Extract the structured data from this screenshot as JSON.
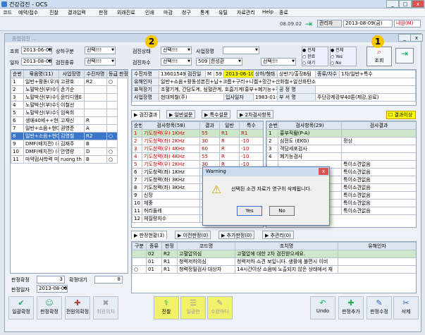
{
  "window": {
    "title": "건강검진 - OCS"
  },
  "menu": [
    "코드",
    "예약/접수",
    "진찰",
    "결과입력",
    "판정",
    "외래진료",
    "인쇄",
    "마감",
    "청구",
    "통계",
    "유틸",
    "자료관리",
    "Help",
    "종료"
  ],
  "top": {
    "version": "08.09.02",
    "role": "관리자",
    "date": "2013-08-09(금)",
    "tab": "내원(M)"
  },
  "inner_title": "종합검진 ...",
  "filters": {
    "jo_label": "조회",
    "jo_date": "2013-06-09",
    "ilja_label": "일자",
    "ilja_date": "2013-08-09",
    "sanghagubun_label": "상하구분",
    "sanghagubun_val": "선택!!!",
    "geomjinjongryu_label": "검진종류",
    "geomjinjongryu_val": "선택!!!",
    "geomjinsangtae_label": "검진상태",
    "geomjinsangtae_val": "선택!!!",
    "geomjinchasu_label": "검진차수",
    "geomjinchasu_val": "선택!!!",
    "saeopjang_label": "사업장명",
    "saeopjang_val": "",
    "saeopjang2_val": "509 |한성환",
    "saeopjang3_val": "선택!!!",
    "radio1": [
      "전체",
      "완료",
      "대기"
    ],
    "radio2": [
      "전체",
      "Yes",
      "No"
    ],
    "search_btn": "조회"
  },
  "list": {
    "headers": [
      "순번",
      "묶음명(11)",
      "사업장명",
      "수진자명",
      "등급",
      "판정"
    ],
    "rows": [
      [
        "1",
        "일반+활동(우)부선",
        "고광호",
        "R2",
        "○"
      ],
      [
        "2",
        "노말박산(부)수영진기타",
        "손기순",
        "",
        ""
      ],
      [
        "3",
        "노말박산(부)수영진기타",
        "윤티디엠E",
        "",
        ""
      ],
      [
        "4",
        "노말박산(부)수영진기타",
        "이철선",
        "",
        ""
      ],
      [
        "5",
        "노말박산(부)수영진기타",
        "임옥희",
        "",
        ""
      ],
      [
        "6",
        "생애40세++현대제출(",
        "고재신",
        "R",
        ""
      ],
      [
        "7",
        "일반+소음+현대제출(",
        "권영준",
        "A",
        ""
      ],
      [
        "8",
        "일반+소음+현대제출(",
        "김영철",
        "R2",
        "○"
      ],
      [
        "9",
        "DMF(배치전) (주)이아이",
        "김재주",
        "B",
        ""
      ],
      [
        "10",
        "DMF(배치전) (주)이아이",
        "안영량",
        "D",
        "○"
      ],
      [
        "11",
        "마약검사학력 미래테크",
        "ruong th",
        "B",
        "○"
      ]
    ]
  },
  "summary": {
    "pangjeong_label": "판정확정",
    "pangjeong_val": "3",
    "hwakjeong_label": "확정대기",
    "hwakjeong_val": "8",
    "date_label": "판정일자",
    "date_val": "2013-08-09"
  },
  "patient": {
    "cols": [
      [
        "수진자명",
        "13601549",
        "검진일",
        "M",
        "59",
        "2013-06-10",
        "상하/형태",
        "상반기/출장B팀",
        "종류/차수",
        "1차/일반+특수"
      ],
      [
        "유해인자",
        "일반+소음+활동성본진+납+크롬+구리+니켈+망간+산화철+알산화탄소"
      ],
      [
        "표적장기",
        "조혈기계, 간담도계, 심혈관계, 호흡기계(흉부+폐기능+객담), 비뇨기",
        "공 정 명",
        ""
      ],
      [
        "사업장명",
        "현대제철(주)",
        "입사일자",
        "1983-01-01",
        "부 서 명",
        "주단강제강부40톤(제강,원료)"
      ]
    ],
    "result_label": "결과이상"
  },
  "tabs1": [
    "검진결과",
    "일반설문",
    "특수설문",
    "2차검사항목"
  ],
  "tests": {
    "headers": [
      "순번",
      "검사항목(58)",
      "결과",
      "일반",
      "특수"
    ],
    "rows": [
      [
        "1",
        "기도청력(우) 1KHz",
        "55",
        "R1",
        "R1"
      ],
      [
        "2",
        "기도청력(좌) 2KHz",
        "30",
        "R",
        "-10"
      ],
      [
        "3",
        "기도청력(우) 4KHz",
        "60",
        "R",
        "-10"
      ],
      [
        "4",
        "기도청력(좌) 4KHz",
        "55",
        "R",
        "-10"
      ],
      [
        "5",
        "기도청력(우) 2KHz",
        "30",
        "R",
        "-10"
      ],
      [
        "6",
        "기도청력(좌) 1KHz",
        "",
        "",
        ""
      ],
      [
        "7",
        "기도청력(좌) 3KHz",
        "",
        "",
        ""
      ],
      [
        "8",
        "기도청력(좌) 3KHz",
        "",
        "",
        ""
      ],
      [
        "9",
        "신장",
        "",
        "",
        ""
      ],
      [
        "10",
        "체중",
        "",
        "",
        ""
      ],
      [
        "11",
        "허리둘레",
        "",
        "",
        ""
      ],
      [
        "12",
        "체질량지수",
        "",
        "",
        ""
      ]
    ]
  },
  "results2": {
    "headers": [
      "순번",
      "검사항목(29)",
      "검사결과"
    ],
    "rows": [
      [
        "1",
        "흉부직촬(P-A)",
        ""
      ],
      [
        "2",
        "심전도 (EKG)",
        "정상"
      ],
      [
        "3",
        "객담세포검사",
        ""
      ],
      [
        "4",
        "폐기능검사",
        ""
      ],
      [
        "",
        "",
        "특이소견없음"
      ],
      [
        "",
        "",
        "특이소견없음"
      ],
      [
        "",
        "",
        "특이소견없음"
      ],
      [
        "",
        "",
        "특이소견없음"
      ],
      [
        "",
        "",
        "특이소견없음"
      ],
      [
        "",
        "",
        "특이소견없음"
      ],
      [
        "",
        "",
        "특이소견없음"
      ]
    ]
  },
  "dialog": {
    "title": "Warning",
    "message": "선택된 소견 자료가 영구히 삭제됩니다.",
    "yes": "Yes",
    "no": "No"
  },
  "tabs2": [
    "판정현황(3)",
    "이전판정(0)",
    "추가판정(0)",
    "추관리(0)"
  ],
  "judg": {
    "headers": [
      "구분",
      "종류",
      "판정",
      "코드명",
      "조치명",
      "유해인자"
    ],
    "rows": [
      [
        "",
        "02",
        "R2",
        "고혈압의심",
        "고혈압에 대한 2차 검진받으세요.",
        ""
      ],
      [
        "",
        "01",
        "R1",
        "청력저하의심",
        "청력저하 소견 보입니다. 생활에 불편시 이비",
        "",
        ""
      ],
      [
        "○",
        "01",
        "R1",
        "청력정밀검사 대상자",
        "14시간이상 소음에 노출되지 않은 상태에서 재",
        "",
        ""
      ]
    ]
  },
  "buttons": [
    "일괄확정",
    "판정확정",
    "전원의확정",
    "취원의차",
    "진찰",
    "일괄판",
    "수완마다",
    "Undo",
    "판정추가",
    "판정수정",
    "삭제"
  ],
  "badges": [
    "1",
    "2",
    "3"
  ],
  "colors": {
    "accent_yellow": "#f7c400",
    "select_blue": "#3a77c8",
    "highlight_yellow": "#ffff00"
  }
}
